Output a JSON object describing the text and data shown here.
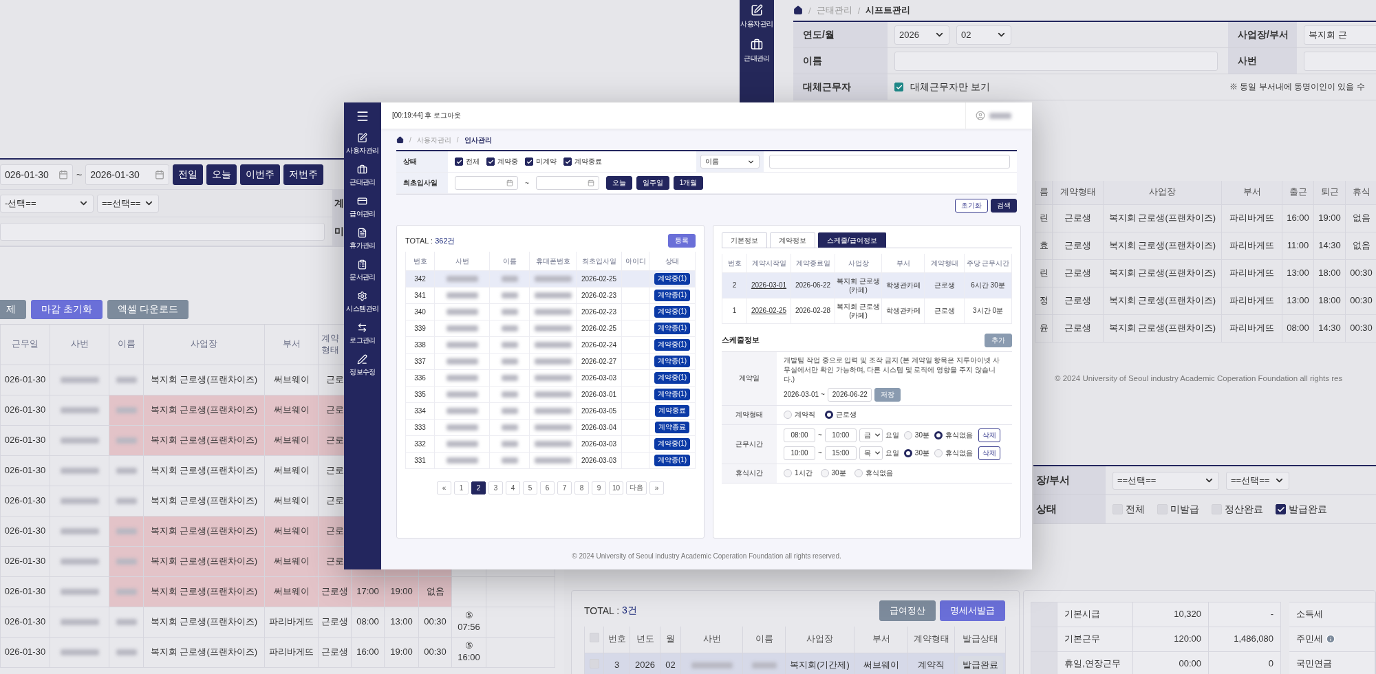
{
  "shift_list": {
    "date_from": "026-01-30",
    "date_to": "2026-01-30",
    "tilde": "~",
    "date_buttons": [
      "전일",
      "오늘",
      "이번주",
      "저번주"
    ],
    "selects": [
      "-선택==",
      "==선택=="
    ],
    "labels": [
      "계",
      "미"
    ],
    "actions": [
      {
        "label": "제",
        "kind": "gray"
      },
      {
        "label": "마감 초기화",
        "kind": "primary"
      },
      {
        "label": "엑셀 다운로드",
        "kind": "gray"
      }
    ],
    "columns": [
      "근무일",
      "사번",
      "이름",
      "사업장",
      "부서",
      "계약 형태"
    ],
    "rows": [
      {
        "date": "026-01-30",
        "highlighted": false,
        "workplace": "복지회 근로생(프랜차이즈)",
        "dept": "써브웨이",
        "contract": "근로"
      },
      {
        "date": "026-01-30",
        "highlighted": true,
        "workplace": "복지회 근로생(프랜차이즈)",
        "dept": "써브웨이",
        "contract": "근로"
      },
      {
        "date": "026-01-30",
        "highlighted": true,
        "workplace": "복지회 근로생(프랜차이즈)",
        "dept": "써브웨이",
        "contract": "근로"
      },
      {
        "date": "026-01-30",
        "highlighted": false,
        "workplace": "복지회 근로생(프랜차이즈)",
        "dept": "써브웨이",
        "contract": "근로"
      },
      {
        "date": "026-01-30",
        "highlighted": false,
        "workplace": "복지회 근로생(프랜차이즈)",
        "dept": "써브웨이",
        "contract": "근로"
      },
      {
        "date": "026-01-30",
        "highlighted": true,
        "workplace": "복지회 근로생(프랜차이즈)",
        "dept": "써브웨이",
        "contract": "근로"
      },
      {
        "date": "026-01-30",
        "highlighted": true,
        "workplace": "복지회 근로생(프랜차이즈)",
        "dept": "써브웨이",
        "contract": "근로"
      },
      {
        "date": "026-01-30",
        "highlighted": true,
        "workplace": "복지회 근로생(프랜차이즈)",
        "dept": "써브웨이",
        "contract": "근로생",
        "times": [
          "17:00",
          "19:00",
          "없음"
        ]
      },
      {
        "date": "026-01-30",
        "highlighted": false,
        "workplace": "복지회 근로생(프랜차이즈)",
        "dept": "파리바게뜨",
        "contract": "근로생",
        "times": [
          "08:00",
          "13:00",
          "00:30"
        ],
        "mark": [
          "⑤",
          "07:56"
        ]
      },
      {
        "date": "026-01-30",
        "highlighted": false,
        "workplace": "복지회 근로생(프랜차이즈)",
        "dept": "파리바게뜨",
        "contract": "근로생",
        "times": [
          "16:00",
          "19:00",
          "00:30"
        ],
        "mark": [
          "⑤",
          "16:00"
        ]
      }
    ]
  },
  "shift_manage": {
    "sidebar": [
      {
        "label": "사용자관리"
      },
      {
        "label": "근태관리"
      }
    ],
    "breadcrumb": [
      "근태관리",
      "시프트관리"
    ],
    "separator": "/",
    "filter_rows": [
      {
        "label": "연도/월",
        "kind": "selects",
        "values": [
          "2026",
          "02"
        ],
        "side_label": "사업장/부서",
        "side_value": "복지회 근"
      },
      {
        "label": "이름",
        "kind": "input",
        "side_label": "사번"
      },
      {
        "label": "대체근무자",
        "kind": "checkbox",
        "checked": true,
        "text": "대체근무자만 보기",
        "note": "※ 동일 부서내에 동명이인이 있을 수"
      }
    ],
    "columns": [
      "름",
      "계약형태",
      "사업장",
      "부서",
      "출근",
      "퇴근",
      "휴식"
    ],
    "rows": [
      [
        "린",
        "근로생",
        "복지회 근로생(프랜차이즈)",
        "파리바게뜨",
        "16:00",
        "19:00",
        "없음"
      ],
      [
        "효",
        "근로생",
        "복지회 근로생(프랜차이즈)",
        "파리바게뜨",
        "11:00",
        "14:30",
        "없음"
      ],
      [
        "린",
        "근로생",
        "복지회 근로생(프랜차이즈)",
        "파리바게뜨",
        "13:00",
        "18:00",
        "00:30"
      ],
      [
        "정",
        "근로생",
        "복지회 근로생(프랜차이즈)",
        "파리바게뜨",
        "13:00",
        "18:00",
        "00:30"
      ],
      [
        "윤",
        "근로생",
        "복지회 근로생(프랜차이즈)",
        "파리바게뜨",
        "08:00",
        "14:30",
        "00:30"
      ]
    ],
    "footer": "© 2024 University of Seoul industry Academic Coperation Foundation all rights res"
  },
  "payroll_filter": {
    "rows": [
      {
        "label": "장/부서",
        "kind": "selects",
        "values": [
          "==선택==",
          "==선택=="
        ]
      },
      {
        "label": "상태",
        "kind": "checks",
        "options": [
          {
            "label": "전체",
            "checked": false
          },
          {
            "label": "미발급",
            "checked": false
          },
          {
            "label": "정산완료",
            "checked": false
          },
          {
            "label": "발급완료",
            "checked": true
          }
        ]
      }
    ]
  },
  "payroll_list": {
    "total_label": "TOTAL :",
    "total": "3건",
    "buttons": [
      {
        "label": "급여정산",
        "kind": "gray"
      },
      {
        "label": "명세서발급",
        "kind": "primary"
      }
    ],
    "columns": [
      "번호",
      "년도",
      "월",
      "사번",
      "이름",
      "사업장",
      "부서",
      "계약형태",
      "발급상태"
    ],
    "select_all_checked": false,
    "rows": [
      {
        "no": "3",
        "year": "2026",
        "month": "02",
        "workplace": "복지회(기간제)",
        "dept": "써브웨이",
        "contract": "계약직",
        "status": "발급완료",
        "selected": true,
        "checked": false
      }
    ]
  },
  "payroll_detail": {
    "rows": [
      {
        "label": "기본시급",
        "value": "10,320",
        "amount": "-",
        "side": "소득세",
        "info": false
      },
      {
        "label": "기본근무",
        "value": "120:00",
        "amount": "1,486,080",
        "side": "주민세",
        "info": true
      },
      {
        "label": "휴일,연장근무",
        "value": "00:00",
        "amount": "0",
        "side": "국민연금",
        "info": false
      }
    ]
  },
  "main": {
    "session": "[00:19:44] 후 로그아웃",
    "sidebar": [
      {
        "label": "사용자관리"
      },
      {
        "label": "근태관리"
      },
      {
        "label": "급여관리"
      },
      {
        "label": "휴가관리"
      },
      {
        "label": "문서관리"
      },
      {
        "label": "시스템관리"
      },
      {
        "label": "로그관리"
      },
      {
        "label": "정보수정"
      }
    ],
    "breadcrumb": [
      "사용자관리",
      "인사관리"
    ],
    "separator": "/",
    "status_label": "상태",
    "status_options": [
      {
        "label": "전체",
        "checked": true
      },
      {
        "label": "계약중",
        "checked": true
      },
      {
        "label": "미계약",
        "checked": true
      },
      {
        "label": "계약종료",
        "checked": true
      }
    ],
    "search_select": "이름",
    "date_label": "최초입사일",
    "tilde": "~",
    "date_buttons": [
      "오늘",
      "일주일",
      "1개월"
    ],
    "reset": "초기화",
    "search": "검색",
    "list": {
      "total_label": "TOTAL :",
      "total": "362건",
      "register": "등록",
      "columns": [
        "번호",
        "사번",
        "이름",
        "휴대폰번호",
        "최초입사일",
        "아이디",
        "상태"
      ],
      "rows": [
        {
          "no": "342",
          "date": "2026-02-25",
          "status": "계약중(1)",
          "selected": true
        },
        {
          "no": "341",
          "date": "2026-02-23",
          "status": "계약중(1)",
          "selected": false
        },
        {
          "no": "340",
          "date": "2026-02-23",
          "status": "계약중(1)",
          "selected": false
        },
        {
          "no": "339",
          "date": "2026-02-25",
          "status": "계약중(1)",
          "selected": false
        },
        {
          "no": "338",
          "date": "2026-02-24",
          "status": "계약중(1)",
          "selected": false
        },
        {
          "no": "337",
          "date": "2026-02-27",
          "status": "계약중(1)",
          "selected": false
        },
        {
          "no": "336",
          "date": "2026-03-03",
          "status": "계약중(1)",
          "selected": false
        },
        {
          "no": "335",
          "date": "2026-03-01",
          "status": "계약중(1)",
          "selected": false
        },
        {
          "no": "334",
          "date": "2026-03-05",
          "status": "계약종료",
          "selected": false
        },
        {
          "no": "333",
          "date": "2026-03-04",
          "status": "계약종료",
          "selected": false
        },
        {
          "no": "332",
          "date": "2026-03-03",
          "status": "계약중(1)",
          "selected": false
        },
        {
          "no": "331",
          "date": "2026-03-03",
          "status": "계약중(1)",
          "selected": false
        }
      ],
      "pages": [
        {
          "label": "«",
          "selected": false
        },
        {
          "label": "1",
          "selected": false
        },
        {
          "label": "2",
          "selected": true
        },
        {
          "label": "3",
          "selected": false
        },
        {
          "label": "4",
          "selected": false
        },
        {
          "label": "5",
          "selected": false
        },
        {
          "label": "6",
          "selected": false
        },
        {
          "label": "7",
          "selected": false
        },
        {
          "label": "8",
          "selected": false
        },
        {
          "label": "9",
          "selected": false
        },
        {
          "label": "10",
          "selected": false
        },
        {
          "label": "다음",
          "selected": false
        },
        {
          "label": "»",
          "selected": false
        }
      ]
    },
    "detail": {
      "tabs": [
        {
          "label": "기본정보",
          "selected": false
        },
        {
          "label": "계약정보",
          "selected": false
        },
        {
          "label": "스케줄/급여정보",
          "selected": true
        }
      ],
      "columns": [
        "번호",
        "계약시작일",
        "계약종료일",
        "사업장",
        "부서",
        "계약형태",
        "주당 근무시간"
      ],
      "contracts": [
        {
          "no": "2",
          "start": "2026-03-01",
          "end": "2026-06-22",
          "workplace": "복지회 근로생 (카페)",
          "dept": "학생관카페",
          "type": "근로생",
          "hours": "6시간 30분",
          "selected": true
        },
        {
          "no": "1",
          "start": "2026-02-25",
          "end": "2026-02-28",
          "workplace": "복지회 근로생 (카페)",
          "dept": "학생관카페",
          "type": "근로생",
          "hours": "3시간 0분",
          "selected": false
        }
      ],
      "schedule_title": "스케줄정보",
      "add": "추가",
      "contract_date": {
        "label": "계약일",
        "note": "개발팀 작업 중으로 입력 및 조작 금지 (본 계약일 항목은 지투아이넷 사무실에서만 확인 가능하며, 다른 시스템 및 로직에 영향을 주지 않습니다.)",
        "start": "2026-03-01 ~",
        "end": "2026-06-22",
        "save": "저장"
      },
      "contract_type": {
        "label": "계약형태",
        "options": [
          {
            "label": "계약직",
            "selected": false
          },
          {
            "label": "근로생",
            "selected": true
          }
        ]
      },
      "work_time": {
        "label": "근무시간",
        "rows": [
          {
            "from": "08:00",
            "sep": "~",
            "to": "10:00",
            "day": "금",
            "day_suffix": "요일",
            "breaks": [
              {
                "label": "30분",
                "selected": false
              },
              {
                "label": "휴식없음",
                "selected": true
              }
            ],
            "delete": "삭제"
          },
          {
            "from": "10:00",
            "sep": "~",
            "to": "15:00",
            "day": "목",
            "day_suffix": "요일",
            "breaks": [
              {
                "label": "30분",
                "selected": true
              },
              {
                "label": "휴식없음",
                "selected": false
              }
            ],
            "delete": "삭제"
          }
        ]
      },
      "rest": {
        "label": "휴식시간",
        "options": [
          {
            "label": "1시간",
            "selected": false
          },
          {
            "label": "30분",
            "selected": false
          },
          {
            "label": "휴식없음",
            "selected": false
          }
        ]
      }
    },
    "footer": "© 2024 University of Seoul industry Academic Coperation Foundation all rights reserved."
  }
}
